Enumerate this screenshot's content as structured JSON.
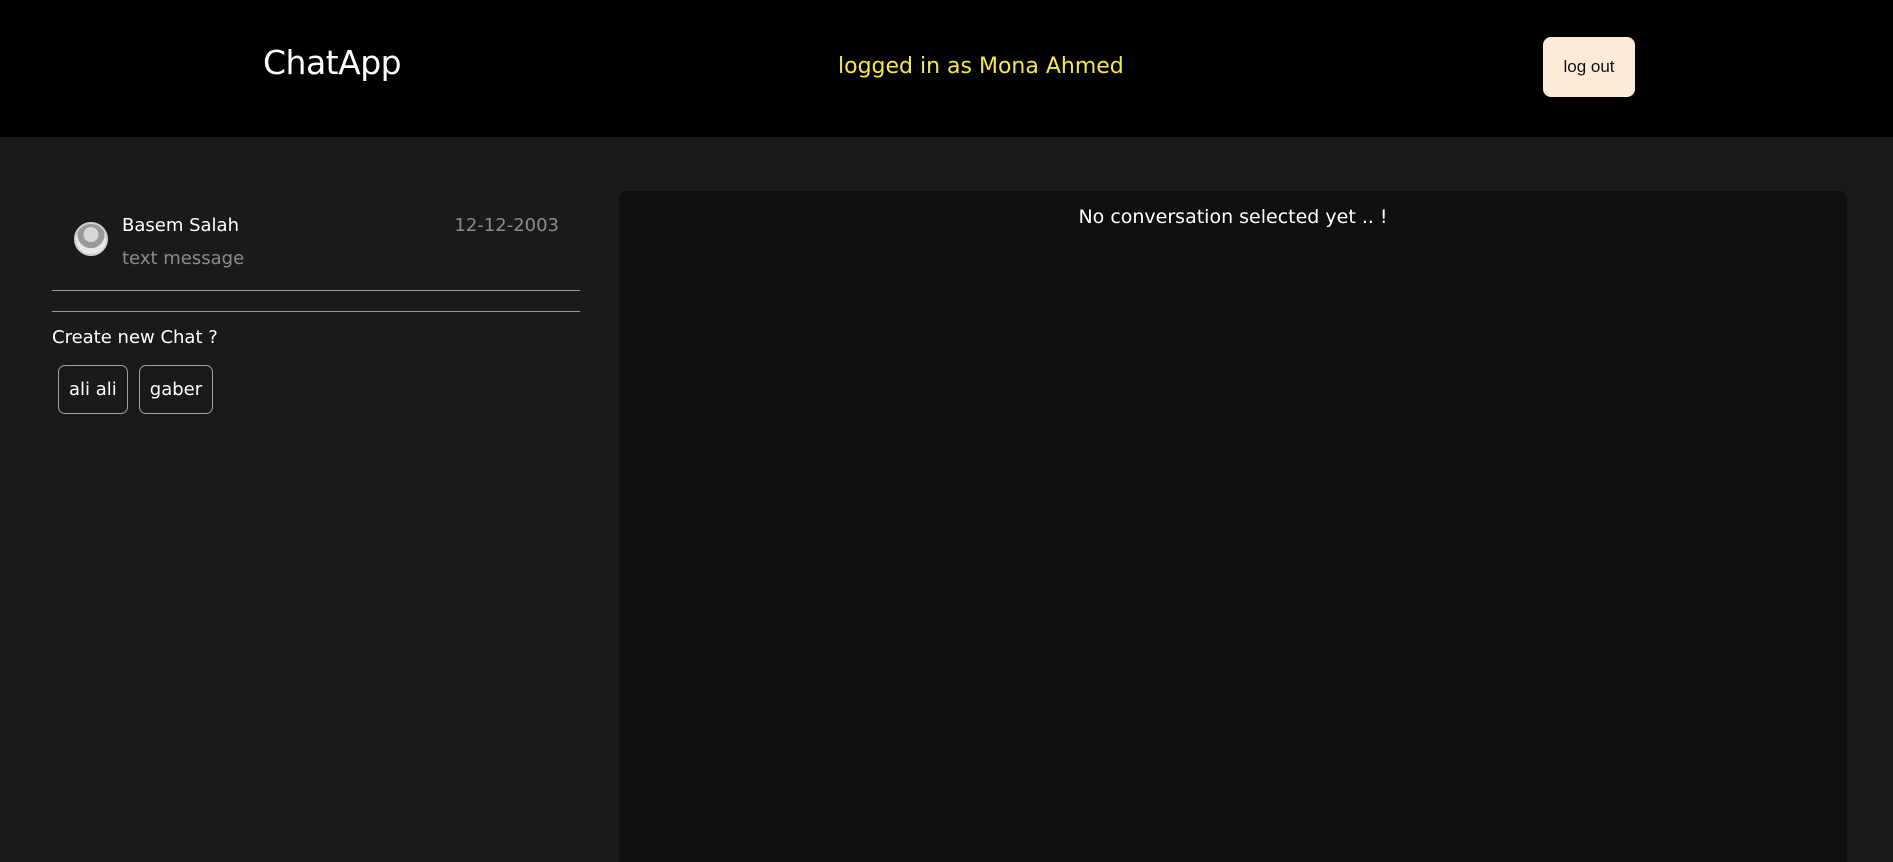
{
  "header": {
    "brand": "ChatApp",
    "logged_in_text": "logged in as Mona Ahmed",
    "logout_label": "log out",
    "accent_color": "#f5e84a"
  },
  "sidebar": {
    "conversations": [
      {
        "name": "Basem Salah",
        "last_message": "text message",
        "date": "12-12-2003",
        "avatar_icon": "user-avatar"
      }
    ],
    "create_label": "Create new Chat ?",
    "users": [
      {
        "label": "ali ali"
      },
      {
        "label": "gaber"
      }
    ]
  },
  "main": {
    "empty_message": "No conversation selected yet .. !"
  }
}
